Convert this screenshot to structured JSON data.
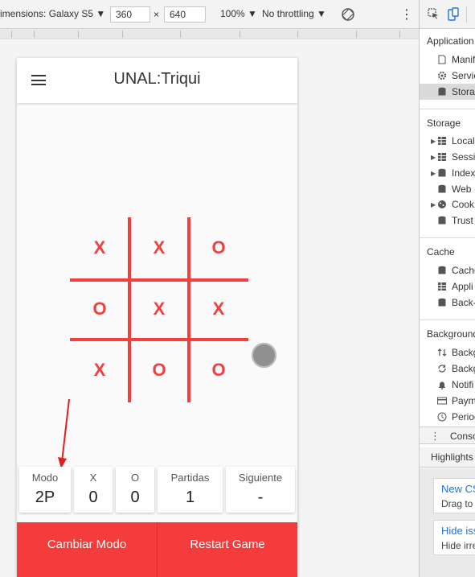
{
  "devtools_toolbar": {
    "device_label": "imensions: Galaxy S5",
    "width_value": "360",
    "times": "×",
    "height_value": "640",
    "zoom": "100%",
    "throttling": "No throttling",
    "dropdown_glyph": "▼",
    "more_glyph": "⋮"
  },
  "app": {
    "title": "UNAL:Triqui",
    "board": [
      [
        "X",
        "X",
        "O"
      ],
      [
        "O",
        "X",
        "X"
      ],
      [
        "X",
        "O",
        "O"
      ]
    ],
    "stats": [
      {
        "label": "Modo",
        "value": "2P"
      },
      {
        "label": "X",
        "value": "0"
      },
      {
        "label": "O",
        "value": "0"
      },
      {
        "label": "Partidas",
        "value": "1"
      },
      {
        "label": "Siguiente",
        "value": "-"
      }
    ],
    "buttons": {
      "change_mode": "Cambiar Modo",
      "restart": "Restart Game"
    },
    "accent_color": "#f53c3c"
  },
  "devtools_panel": {
    "application_header": "Application",
    "application_items": [
      "Manif",
      "Servic",
      "Stora"
    ],
    "storage_header": "Storage",
    "storage_items": [
      "Local",
      "Sessio",
      "Index",
      "Web",
      "Cook",
      "Trust"
    ],
    "cache_header": "Cache",
    "cache_items": [
      "Cache",
      "Appli",
      "Back-"
    ],
    "background_header": "Background",
    "background_items": [
      "Backg",
      "Backg",
      "Notifi",
      "Paym",
      "Period"
    ],
    "console_tab": "Conso",
    "highlights_tab": "Highlights",
    "issues": [
      {
        "title": "New CS",
        "sub": "Drag to"
      },
      {
        "title": "Hide iss",
        "sub": "Hide irre"
      }
    ]
  }
}
